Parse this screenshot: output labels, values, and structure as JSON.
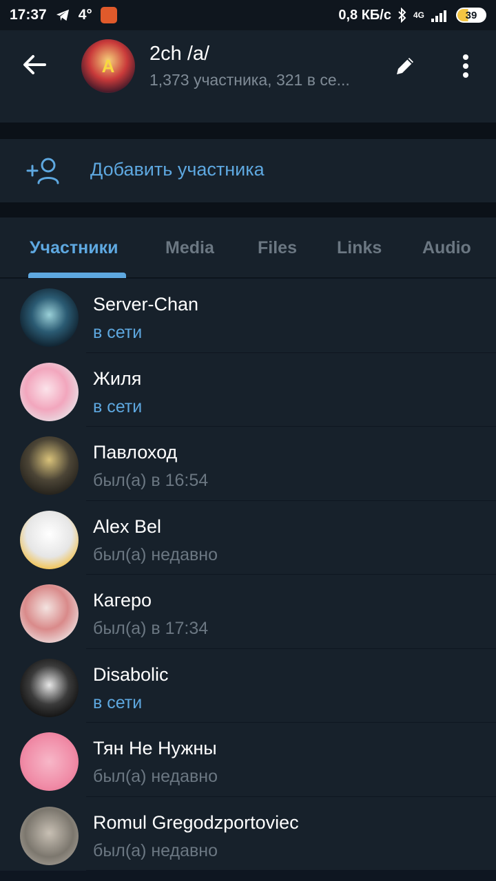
{
  "status_bar": {
    "time": "17:37",
    "temperature": "4°",
    "network_speed": "0,8 КБ/с",
    "network_type": "4G",
    "battery": "39"
  },
  "header": {
    "title": "2ch /a/",
    "subtitle": "1,373 участника, 321 в се...",
    "avatar_letter": "A"
  },
  "add_member": {
    "label": "Добавить участника"
  },
  "tabs": [
    {
      "label": "Участники",
      "active": true
    },
    {
      "label": "Media",
      "active": false
    },
    {
      "label": "Files",
      "active": false
    },
    {
      "label": "Links",
      "active": false
    },
    {
      "label": "Audio",
      "active": false
    }
  ],
  "members": [
    {
      "name": "Server-Chan",
      "status": "в сети",
      "online": true
    },
    {
      "name": "Жиля",
      "status": "в сети",
      "online": true
    },
    {
      "name": "Павлоход",
      "status": "был(а) в 16:54",
      "online": false
    },
    {
      "name": "Alex Bel",
      "status": "был(а) недавно",
      "online": false
    },
    {
      "name": "Кагеро",
      "status": "был(а) в 17:34",
      "online": false
    },
    {
      "name": "Disabolic",
      "status": "в сети",
      "online": true
    },
    {
      "name": "Тян Не Нужны",
      "status": "был(а) недавно",
      "online": false
    },
    {
      "name": "Romul Gregodzportoviec",
      "status": "был(а) недавно",
      "online": false
    }
  ],
  "colors": {
    "accent": "#5ea8e0",
    "background": "#17212b",
    "muted": "#6b7782"
  }
}
